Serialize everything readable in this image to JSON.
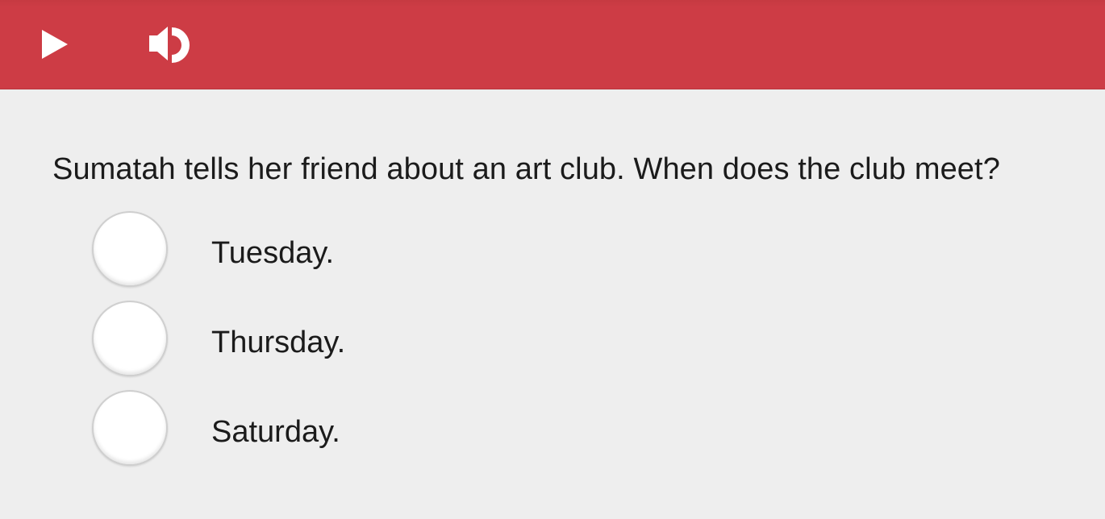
{
  "toolbar": {
    "play_icon": "play-icon",
    "audio_icon": "speaker-icon",
    "background_color": "#cd3c45",
    "icon_color": "#ffffff"
  },
  "question": {
    "text": "Sumatah tells her friend about an art club. When does the club meet?"
  },
  "options": [
    {
      "label": "Tuesday.",
      "selected": false
    },
    {
      "label": "Thursday.",
      "selected": false
    },
    {
      "label": "Saturday.",
      "selected": false
    }
  ]
}
